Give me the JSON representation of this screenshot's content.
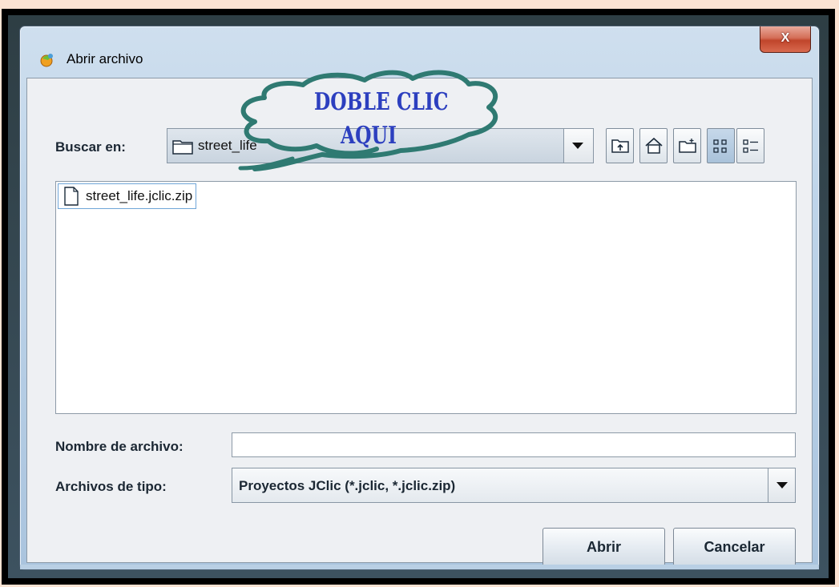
{
  "window": {
    "title": "Abrir archivo",
    "close_label": "X"
  },
  "look_in": {
    "label": "Buscar en:",
    "value": "street_life"
  },
  "files": [
    {
      "name": "street_life.jclic.zip"
    }
  ],
  "filename": {
    "label": "Nombre de archivo:",
    "value": ""
  },
  "filetype": {
    "label": "Archivos de tipo:",
    "value": "Proyectos JClic (*.jclic, *.jclic.zip)"
  },
  "buttons": {
    "open": "Abrir",
    "cancel": "Cancelar"
  },
  "annotation": {
    "line1": "DOBLE CLIC",
    "line2": "AQUI"
  },
  "colors": {
    "annotation_text": "#2c3fbf",
    "annotation_cloud": "#2f7a72",
    "close_button": "#c0452b"
  }
}
